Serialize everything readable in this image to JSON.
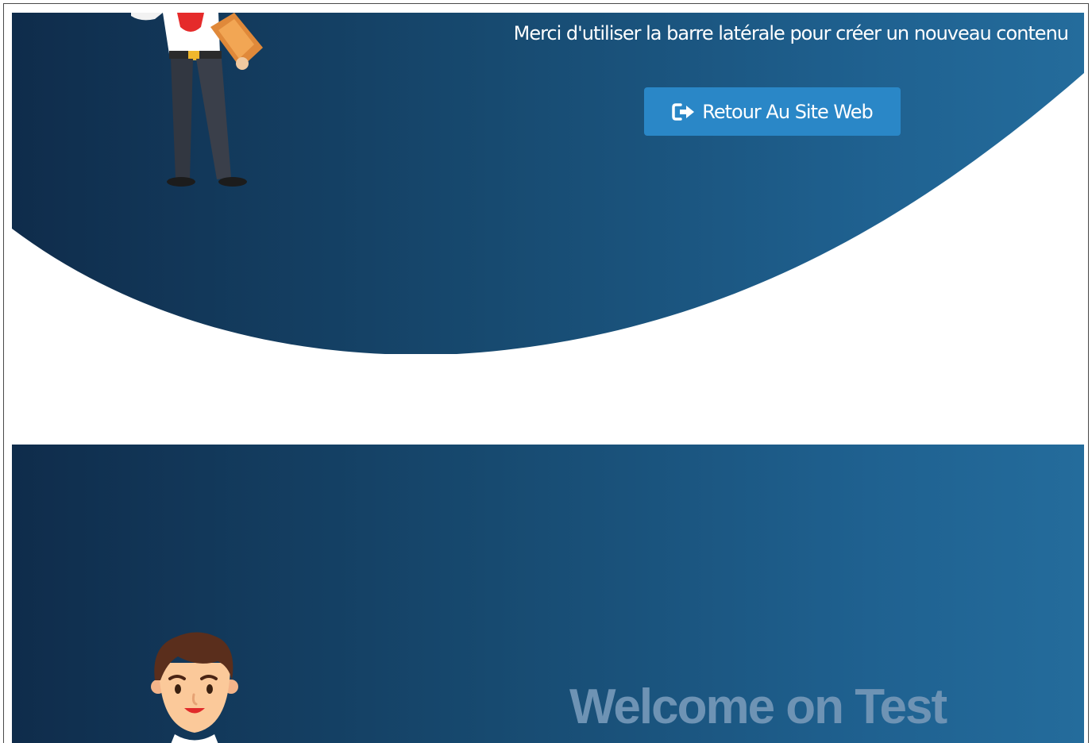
{
  "hero": {
    "message": "Merci d'utiliser la barre latérale pour créer un nouveau contenu",
    "return_button": {
      "label": "Retour Au Site Web",
      "icon": "sign-out-icon"
    }
  },
  "welcome_section": {
    "title": "Welcome on Test"
  },
  "colors": {
    "gradient_start": "#0f2c4b",
    "gradient_end": "#246c9c",
    "button": "#2a87c7",
    "welcome_text": "#6e93b4"
  }
}
